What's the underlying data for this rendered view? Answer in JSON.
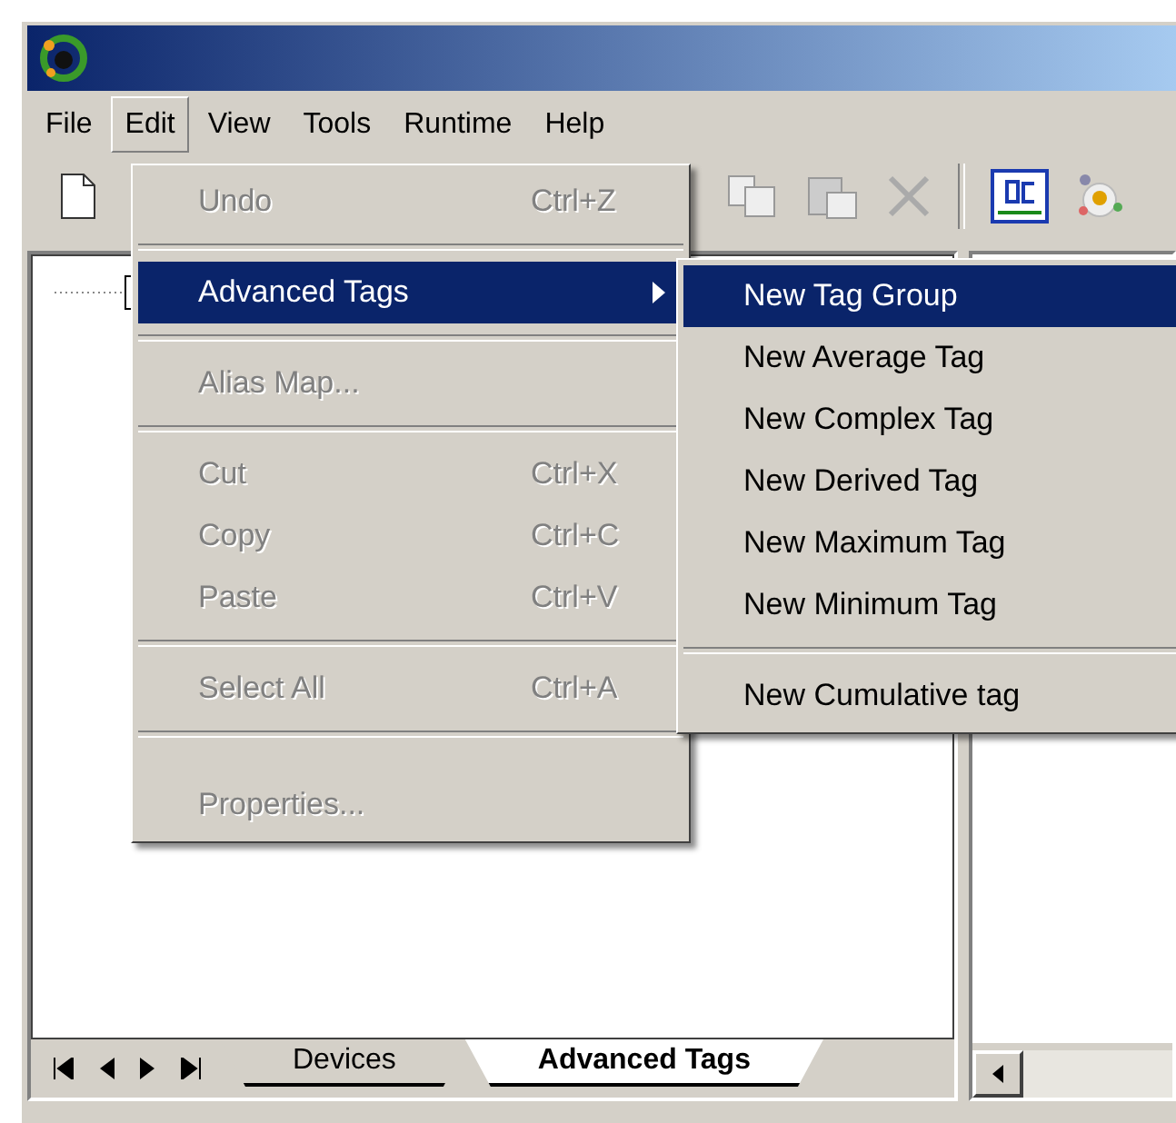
{
  "menubar": [
    {
      "label": "File",
      "selected": false
    },
    {
      "label": "Edit",
      "selected": true
    },
    {
      "label": "View",
      "selected": false
    },
    {
      "label": "Tools",
      "selected": false
    },
    {
      "label": "Runtime",
      "selected": false
    },
    {
      "label": "Help",
      "selected": false
    }
  ],
  "edit_menu": [
    {
      "kind": "item",
      "label": "Undo",
      "shortcut": "Ctrl+Z",
      "disabled": true,
      "selected": false
    },
    {
      "kind": "separator"
    },
    {
      "kind": "submenu",
      "label": "Advanced Tags",
      "disabled": false,
      "selected": true
    },
    {
      "kind": "separator"
    },
    {
      "kind": "item",
      "label": "Alias Map...",
      "disabled": true,
      "selected": false
    },
    {
      "kind": "separator"
    },
    {
      "kind": "item",
      "label": "Cut",
      "shortcut": "Ctrl+X",
      "disabled": true,
      "selected": false
    },
    {
      "kind": "item",
      "label": "Copy",
      "shortcut": "Ctrl+C",
      "disabled": true,
      "selected": false
    },
    {
      "kind": "item",
      "label": "Paste",
      "shortcut": "Ctrl+V",
      "disabled": true,
      "selected": false
    },
    {
      "kind": "separator"
    },
    {
      "kind": "item",
      "label": "Select All",
      "shortcut": "Ctrl+A",
      "disabled": true,
      "selected": false
    },
    {
      "kind": "separator"
    },
    {
      "kind": "spacer"
    },
    {
      "kind": "item",
      "label": "Properties...",
      "disabled": true,
      "selected": false
    }
  ],
  "advanced_tags_submenu": [
    {
      "kind": "item",
      "label": "New Tag Group",
      "selected": true
    },
    {
      "kind": "item",
      "label": "New Average Tag",
      "selected": false
    },
    {
      "kind": "item",
      "label": "New Complex Tag",
      "selected": false
    },
    {
      "kind": "item",
      "label": "New Derived Tag",
      "selected": false
    },
    {
      "kind": "item",
      "label": "New Maximum Tag",
      "selected": false
    },
    {
      "kind": "item",
      "label": "New Minimum Tag",
      "selected": false
    },
    {
      "kind": "separator"
    },
    {
      "kind": "item",
      "label": "New Cumulative tag",
      "selected": false
    }
  ],
  "tabs": [
    {
      "label": "Devices",
      "selected": false
    },
    {
      "label": "Advanced Tags",
      "selected": true
    }
  ]
}
